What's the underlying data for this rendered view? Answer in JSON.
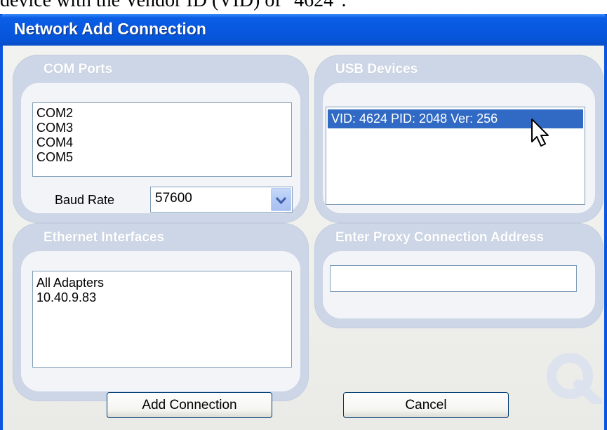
{
  "document": {
    "fragment": "device with the Vendor ID (VID) of \"4624\"."
  },
  "window": {
    "title": "Network Add Connection"
  },
  "com_ports": {
    "title": "COM Ports",
    "items": [
      "COM2",
      "COM3",
      "COM4",
      "COM5"
    ],
    "baud_label": "Baud Rate",
    "baud_value": "57600"
  },
  "usb_devices": {
    "title": "USB Devices",
    "items": [
      "VID: 4624 PID: 2048 Ver: 256"
    ],
    "selected_index": 0
  },
  "ethernet": {
    "title": "Ethernet Interfaces",
    "items": [
      "All Adapters",
      "10.40.9.83"
    ]
  },
  "proxy": {
    "title": "Enter Proxy Connection Address",
    "value": ""
  },
  "buttons": {
    "add": "Add Connection",
    "cancel": "Cancel"
  },
  "colors": {
    "titlebar": "#0858e0",
    "selection": "#316ac5",
    "group_frame": "#cdd6e6"
  },
  "icons": [
    "chevron-down-icon",
    "mouse-pointer-icon",
    "logo-q-icon"
  ]
}
